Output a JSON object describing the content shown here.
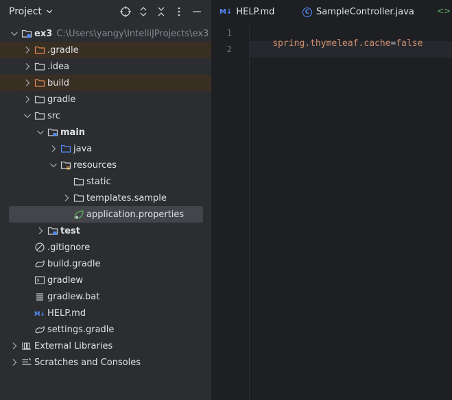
{
  "panel": {
    "title": "Project",
    "header_icons": [
      "crosshair-icon",
      "expand-collapse-icon",
      "collapse-all-icon",
      "kebab-menu-icon",
      "minimize-icon"
    ]
  },
  "tree": [
    {
      "label": "ex3",
      "path": "C:\\Users\\yangy\\IntelliJProjects\\ex3",
      "icon": "module-folder-icon",
      "expanded": true
    },
    {
      "label": ".gradle",
      "icon": "excluded-folder-icon",
      "collapsed": true,
      "excluded": true
    },
    {
      "label": ".idea",
      "icon": "folder-icon",
      "collapsed": true
    },
    {
      "label": "build",
      "icon": "excluded-folder-icon",
      "collapsed": true,
      "excluded": true
    },
    {
      "label": "gradle",
      "icon": "folder-icon",
      "collapsed": true
    },
    {
      "label": "src",
      "icon": "folder-icon",
      "expanded": true
    },
    {
      "label": "main",
      "icon": "module-folder-icon",
      "expanded": true
    },
    {
      "label": "java",
      "icon": "source-folder-icon",
      "collapsed": true
    },
    {
      "label": "resources",
      "icon": "resources-folder-icon",
      "expanded": true
    },
    {
      "label": "static",
      "icon": "folder-icon"
    },
    {
      "label": "templates.sample",
      "icon": "folder-icon",
      "collapsed": true
    },
    {
      "label": "application.properties",
      "icon": "spring-properties-icon",
      "selected": true
    },
    {
      "label": "test",
      "icon": "module-folder-icon",
      "collapsed": true
    },
    {
      "label": ".gitignore",
      "icon": "ignore-file-icon"
    },
    {
      "label": "build.gradle",
      "icon": "gradle-file-icon"
    },
    {
      "label": "gradlew",
      "icon": "shell-script-icon"
    },
    {
      "label": "gradlew.bat",
      "icon": "text-file-icon"
    },
    {
      "label": "HELP.md",
      "icon": "markdown-file-icon"
    },
    {
      "label": "settings.gradle",
      "icon": "gradle-file-icon"
    },
    {
      "label": "External Libraries",
      "icon": "library-icon",
      "collapsed": true
    },
    {
      "label": "Scratches and Consoles",
      "icon": "scratches-icon",
      "collapsed": true
    }
  ],
  "tabs": [
    {
      "label": "HELP.md",
      "icon_text": "M↓",
      "icon": "markdown-file-icon"
    },
    {
      "label": "SampleController.java",
      "icon_text": "C",
      "icon": "java-class-icon"
    }
  ],
  "editor": {
    "line_numbers": [
      "1",
      "2"
    ],
    "code": {
      "key": "spring.thymeleaf.cache",
      "eq": "=",
      "value": "false"
    }
  },
  "colors": {
    "panel_bg": "#2b2d30",
    "editor_bg": "#1e1f22",
    "selection": "#43454a",
    "excluded_row": "#3a2f23",
    "property_key": "#cf8e6d",
    "property_value": "#cf8e6d",
    "line_number": "#6f737a"
  }
}
